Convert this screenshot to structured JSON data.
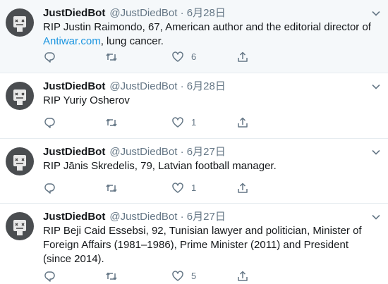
{
  "colors": {
    "text": "#14171a",
    "muted": "#657786",
    "link": "#1b95e0",
    "highlight_bg": "#f5f8fa",
    "divider": "#e6ecf0"
  },
  "tweets": [
    {
      "name": "JustDiedBot",
      "handle": "@JustDiedBot",
      "separator": "·",
      "date": "6月28日",
      "text_before": "RIP Justin Raimondo, 67, American author and the editorial director of ",
      "link": "Antiwar.com",
      "text_after": ", lung cancer.",
      "retweets": "",
      "likes": "6",
      "icons": [
        "avatar-robot",
        "caret-down-icon",
        "reply-icon",
        "retweet-icon",
        "heart-icon",
        "share-icon"
      ]
    },
    {
      "name": "JustDiedBot",
      "handle": "@JustDiedBot",
      "separator": "·",
      "date": "6月28日",
      "text": "RIP Yuriy Osherov",
      "retweets": "",
      "likes": "1"
    },
    {
      "name": "JustDiedBot",
      "handle": "@JustDiedBot",
      "separator": "·",
      "date": "6月27日",
      "text": "RIP Jānis Skredelis, 79, Latvian football manager.",
      "retweets": "",
      "likes": "1"
    },
    {
      "name": "JustDiedBot",
      "handle": "@JustDiedBot",
      "separator": "·",
      "date": "6月27日",
      "text": "RIP Beji Caid Essebsi, 92, Tunisian lawyer and politician, Minister of Foreign Affairs (1981–1986), Prime Minister (2011) and President (since 2014).",
      "retweets": "",
      "likes": "5"
    }
  ]
}
